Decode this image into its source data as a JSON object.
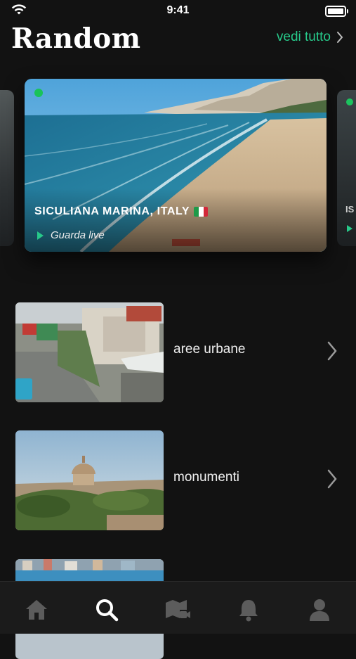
{
  "status_bar": {
    "time": "9:41"
  },
  "header": {
    "title": "Random",
    "see_all_label": "vedi tutto"
  },
  "hero": {
    "location": "SICULIANA MARINA, ITALY",
    "watch_label": "Guarda live",
    "live": true,
    "flag_colors": [
      "#1e9a48",
      "#ffffff",
      "#d2283a"
    ]
  },
  "next_card": {
    "partial_text": "IS"
  },
  "categories": [
    {
      "label": "aree urbane",
      "icon": "chevron-right-icon"
    },
    {
      "label": "monumenti",
      "icon": "chevron-right-icon"
    },
    {
      "label": "",
      "icon": ""
    }
  ],
  "tabbar": {
    "tabs": [
      {
        "icon": "home-icon",
        "active": false
      },
      {
        "icon": "search-icon",
        "active": true
      },
      {
        "icon": "map-camera-icon",
        "active": false
      },
      {
        "icon": "bell-icon",
        "active": false
      },
      {
        "icon": "profile-icon",
        "active": false
      }
    ]
  },
  "colors": {
    "background": "#121212",
    "accent": "#27c98a",
    "live_dot": "#19c35a",
    "tab_inactive": "#5c5c5c",
    "tab_active": "#ffffff"
  }
}
